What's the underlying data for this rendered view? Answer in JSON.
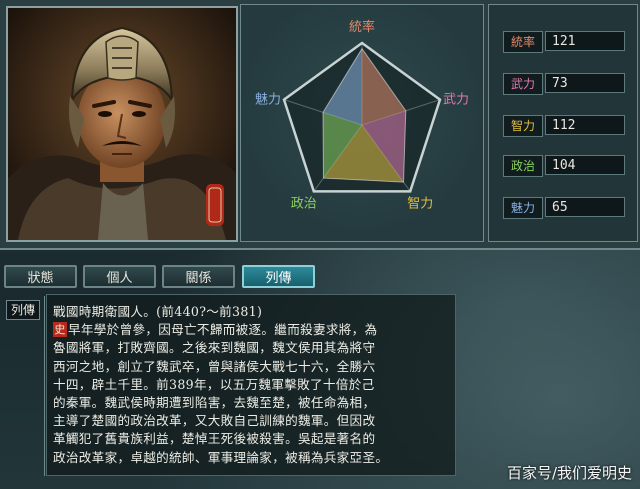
{
  "stats": {
    "axes": [
      {
        "key": "leadership",
        "label": "統率",
        "value": 121,
        "color": "#e08a6a"
      },
      {
        "key": "war",
        "label": "武力",
        "value": 73,
        "color": "#e07ab0"
      },
      {
        "key": "intelligence",
        "label": "智力",
        "value": 112,
        "color": "#e0c040"
      },
      {
        "key": "politics",
        "label": "政治",
        "value": 104,
        "color": "#8ad060"
      },
      {
        "key": "charisma",
        "label": "魅力",
        "value": 65,
        "color": "#8ab0e0"
      }
    ],
    "max": 130
  },
  "tabs": [
    {
      "label": "狀態",
      "active": false
    },
    {
      "label": "個人",
      "active": false
    },
    {
      "label": "關係",
      "active": false
    },
    {
      "label": "列傳",
      "active": true
    }
  ],
  "bio": {
    "tag": "列傳",
    "mark": "史",
    "lines": [
      "戰國時期衛國人。(前440?～前381)",
      "早年學於曾參，因母亡不歸而被逐。繼而殺妻求將，為",
      "魯國將軍，打敗齊國。之後來到魏國，魏文侯用其為將守",
      "西河之地，創立了魏武卒，曾與諸侯大戰七十六，全勝六",
      "十四，辟土千里。前389年，以五万魏軍擊敗了十倍於己",
      "的秦軍。魏武侯時期遭到陷害，去魏至楚，被任命為相，",
      "主導了楚國的政治改革，又大敗自己訓練的魏軍。但因改",
      "革觸犯了舊貴族利益，楚悼王死後被殺害。吳起是著名的",
      "政治改革家，卓越的統帥、軍事理論家，被稱為兵家亞圣。"
    ]
  },
  "watermark": "百家号/我们爱明史"
}
